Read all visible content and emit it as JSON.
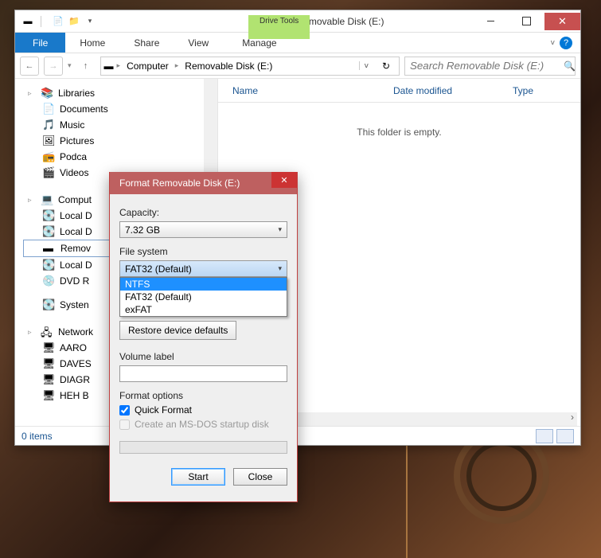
{
  "titlebar": {
    "title": "Removable Disk (E:)",
    "drive_tools_label": "Drive Tools"
  },
  "ribbon": {
    "file": "File",
    "home": "Home",
    "share": "Share",
    "view": "View",
    "manage": "Manage"
  },
  "breadcrumb": {
    "computer": "Computer",
    "disk": "Removable Disk (E:)"
  },
  "search": {
    "placeholder": "Search Removable Disk (E:)"
  },
  "columns": {
    "name": "Name",
    "date": "Date modified",
    "type": "Type"
  },
  "empty_text": "This folder is empty.",
  "status_items": "0 items",
  "tree": {
    "libraries": "Libraries",
    "documents": "Documents",
    "music": "Music",
    "pictures": "Pictures",
    "podcasts": "Podca",
    "videos": "Videos",
    "computer": "Comput",
    "ld1": "Local D",
    "ld2": "Local D",
    "remov": "Remov",
    "ld3": "Local D",
    "dvd": "DVD R",
    "system": "Systen",
    "network": "Network",
    "n1": "AARO",
    "n2": "DAVES",
    "n3": "DIAGR",
    "n4": "HEH B"
  },
  "dialog": {
    "title": "Format Removable Disk (E:)",
    "capacity_label": "Capacity:",
    "capacity_value": "7.32 GB",
    "fs_label": "File system",
    "fs_value": "FAT32 (Default)",
    "fs_opts": {
      "ntfs": "NTFS",
      "fat32": "FAT32 (Default)",
      "exfat": "exFAT"
    },
    "restore": "Restore device defaults",
    "volume_label": "Volume label",
    "format_options": "Format options",
    "quick": "Quick Format",
    "msdos": "Create an MS-DOS startup disk",
    "start": "Start",
    "close": "Close"
  }
}
